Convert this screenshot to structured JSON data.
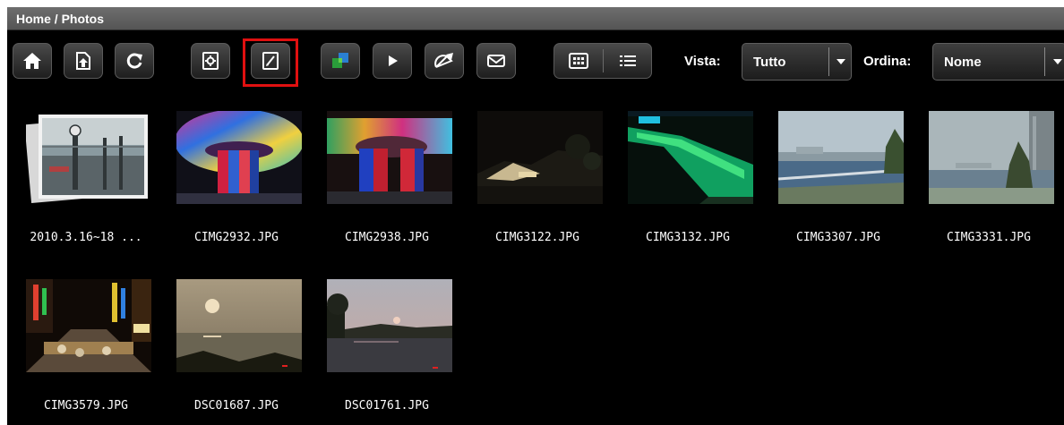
{
  "breadcrumb": {
    "home": "Home",
    "separator": " / ",
    "current": "Photos"
  },
  "toolbar": {
    "buttons": [
      {
        "name": "home-button",
        "icon": "home-icon"
      },
      {
        "name": "upload-button",
        "icon": "upload-icon"
      },
      {
        "name": "refresh-button",
        "icon": "refresh-icon"
      },
      {
        "name": "settings-button",
        "icon": "settings-icon"
      },
      {
        "name": "edit-button",
        "icon": "edit-icon",
        "highlighted": true
      },
      {
        "name": "slideshow-effect-button",
        "icon": "windows-icon"
      },
      {
        "name": "play-button",
        "icon": "play-icon"
      },
      {
        "name": "share-button",
        "icon": "satellite-icon"
      },
      {
        "name": "email-button",
        "icon": "envelope-icon"
      }
    ],
    "view_modes": [
      {
        "name": "grid-view-button",
        "icon": "grid-icon",
        "active": true
      },
      {
        "name": "list-view-button",
        "icon": "list-icon",
        "active": false
      }
    ],
    "vista_label": "Vista:",
    "vista_value": "Tutto",
    "ordina_label": "Ordina:",
    "ordina_value": "Nome"
  },
  "highlight_color": "#e01010",
  "items": [
    {
      "name": "2010.3.16~18 ...",
      "type": "album"
    },
    {
      "name": "CIMG2932.JPG",
      "type": "photo"
    },
    {
      "name": "CIMG2938.JPG",
      "type": "photo"
    },
    {
      "name": "CIMG3122.JPG",
      "type": "photo"
    },
    {
      "name": "CIMG3132.JPG",
      "type": "photo"
    },
    {
      "name": "CIMG3307.JPG",
      "type": "photo"
    },
    {
      "name": "CIMG3331.JPG",
      "type": "photo"
    },
    {
      "name": "CIMG3579.JPG",
      "type": "photo"
    },
    {
      "name": "DSC01687.JPG",
      "type": "photo"
    },
    {
      "name": "DSC01761.JPG",
      "type": "photo"
    }
  ]
}
